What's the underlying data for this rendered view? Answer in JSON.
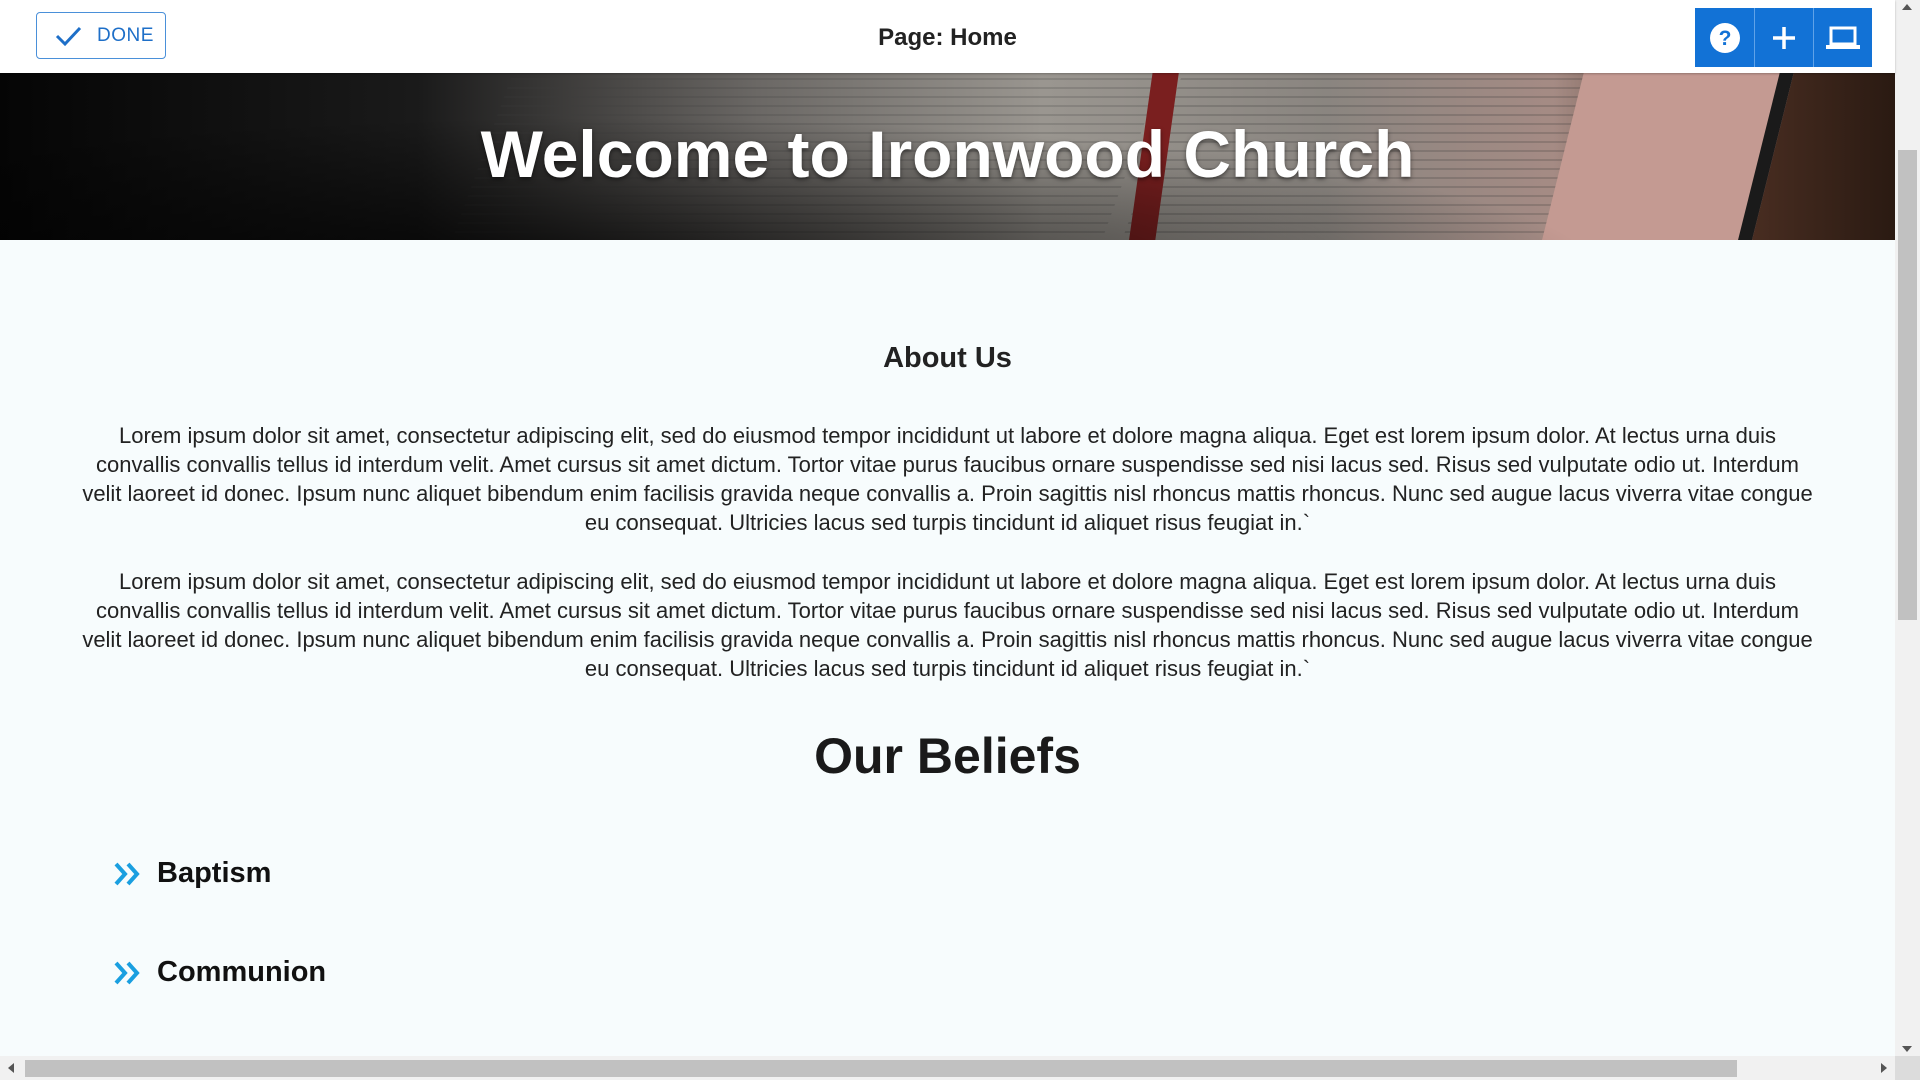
{
  "toolbar": {
    "done_label": "DONE",
    "page_title": "Page: Home",
    "buttons": [
      {
        "icon": "help-icon"
      },
      {
        "icon": "plus-icon"
      },
      {
        "icon": "laptop-icon"
      }
    ],
    "accent_color": "#1272d6"
  },
  "hero": {
    "title": "Welcome to Ironwood Church"
  },
  "about": {
    "heading": "About Us",
    "paragraphs": [
      "Lorem ipsum dolor sit amet, consectetur adipiscing elit, sed do eiusmod tempor incididunt ut labore et dolore magna aliqua. Eget est lorem ipsum dolor. At lectus urna duis convallis convallis tellus id interdum velit. Amet cursus sit amet dictum. Tortor vitae purus faucibus ornare suspendisse sed nisi lacus sed. Risus sed vulputate odio ut. Interdum velit laoreet id donec. Ipsum nunc aliquet bibendum enim facilisis gravida neque convallis a. Proin sagittis nisl rhoncus mattis rhoncus. Nunc sed augue lacus viverra vitae congue eu consequat. Ultricies lacus sed turpis tincidunt id aliquet risus feugiat in.`",
      "Lorem ipsum dolor sit amet, consectetur adipiscing elit, sed do eiusmod tempor incididunt ut labore et dolore magna aliqua. Eget est lorem ipsum dolor. At lectus urna duis convallis convallis tellus id interdum velit. Amet cursus sit amet dictum. Tortor vitae purus faucibus ornare suspendisse sed nisi lacus sed. Risus sed vulputate odio ut. Interdum velit laoreet id donec. Ipsum nunc aliquet bibendum enim facilisis gravida neque convallis a. Proin sagittis nisl rhoncus mattis rhoncus. Nunc sed augue lacus viverra vitae congue eu consequat. Ultricies lacus sed turpis tincidunt id aliquet risus feugiat in.`"
    ]
  },
  "beliefs": {
    "heading": "Our Beliefs",
    "items": [
      {
        "label": "Baptism",
        "icon": "double-chevron-right-icon"
      },
      {
        "label": "Communion",
        "icon": "double-chevron-right-icon"
      }
    ],
    "chevron_color": "#1a9fe0"
  }
}
